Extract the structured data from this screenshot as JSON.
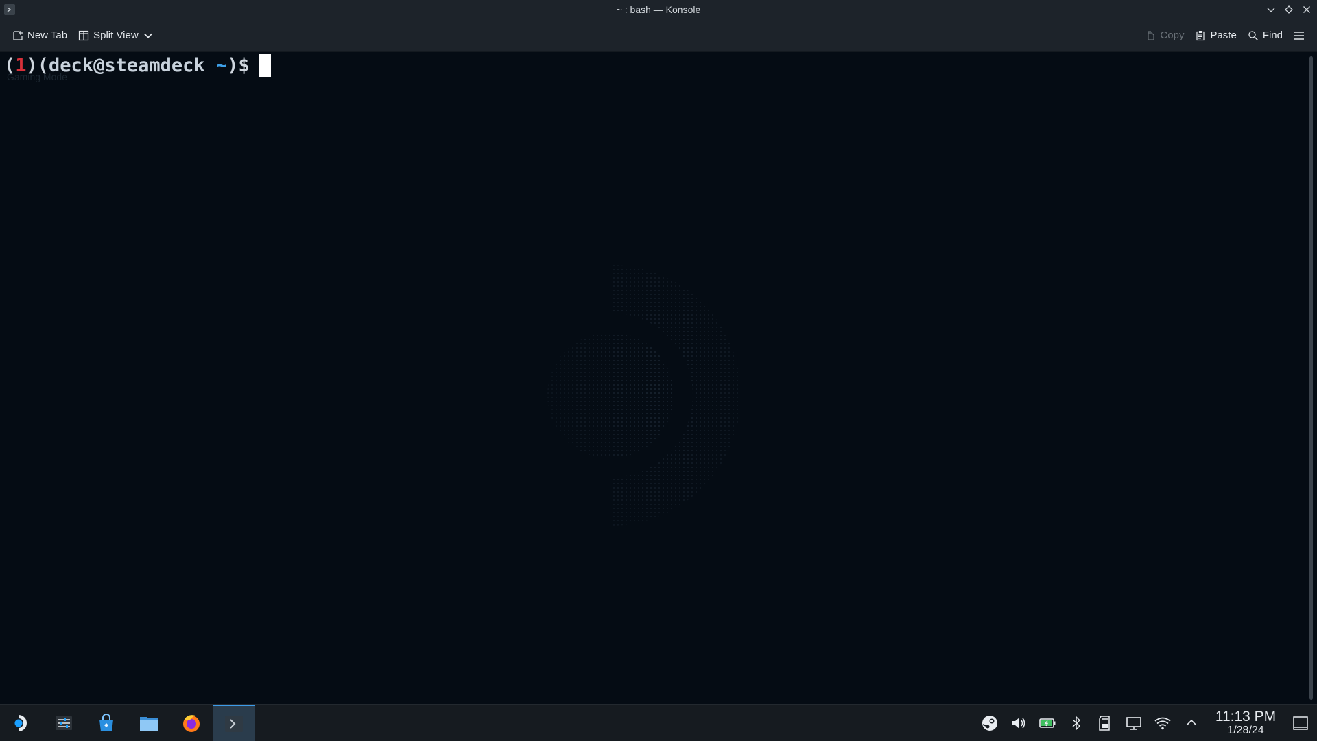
{
  "window": {
    "title": "~ : bash — Konsole"
  },
  "toolbar": {
    "new_tab_label": "New Tab",
    "split_view_label": "Split View",
    "copy_label": "Copy",
    "paste_label": "Paste",
    "find_label": "Find"
  },
  "terminal": {
    "prompt": {
      "open_paren1": "(",
      "number": "1",
      "close_open": ")(",
      "user_host": "deck@steamdeck",
      "space": " ",
      "tilde": "~",
      "suffix": ")$"
    },
    "ghost_label": "Gaming Mode"
  },
  "taskbar": {
    "apps": [
      "steam-launcher-icon",
      "system-settings-icon",
      "discover-store-icon",
      "file-manager-icon",
      "firefox-icon",
      "konsole-icon"
    ],
    "tray": [
      "steam-tray-icon",
      "volume-icon",
      "battery-icon",
      "bluetooth-icon",
      "sd-card-icon",
      "display-icon",
      "wifi-icon",
      "expand-tray-icon"
    ],
    "clock_time": "11:13 PM",
    "clock_date": "1/28/24"
  },
  "colors": {
    "background": "#050c14",
    "chrome": "#1d232a",
    "prompt_number": "#d8303a",
    "prompt_tilde": "#3ea0e8",
    "accent": "#3d9be8"
  }
}
